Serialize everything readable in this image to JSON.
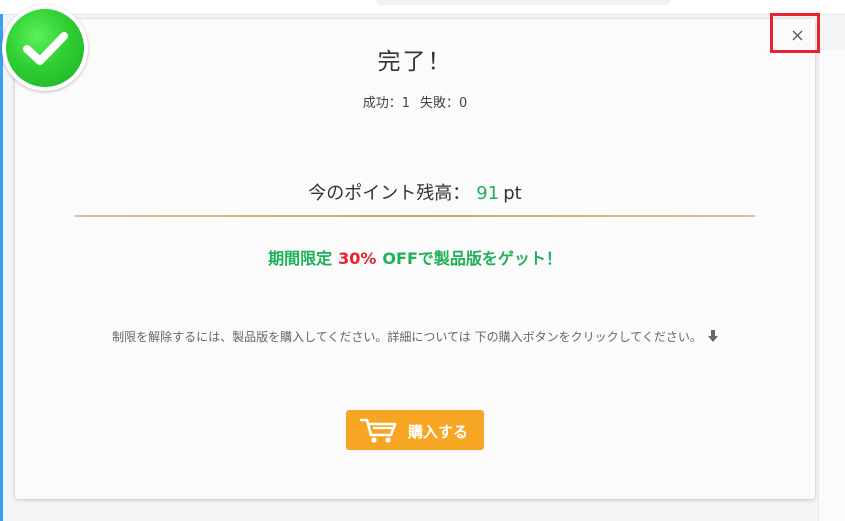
{
  "dialog": {
    "title": "完了！",
    "result": {
      "success_label": "成功：1",
      "failure_label": "失敗：0"
    },
    "points": {
      "prefix": "今のポイント残高：",
      "value": "91",
      "unit": "pt"
    },
    "promo": {
      "prefix": "期間限定",
      "percent": "30%",
      "suffix": "OFFで製品版をゲット！"
    },
    "hint": "制限を解除するには、製品版を購入してください。詳細については 下の購入ボタンをクリックしてください。",
    "buy_button_label": "購入する",
    "close_icon": "close-icon",
    "success_icon": "check-icon",
    "cart_icon": "cart-icon",
    "arrow_icon": "arrow-down-icon"
  },
  "colors": {
    "accent_green": "#1fb05a",
    "promo_red": "#e8232c",
    "button_orange": "#f6a623",
    "close_highlight": "#e8232c"
  }
}
